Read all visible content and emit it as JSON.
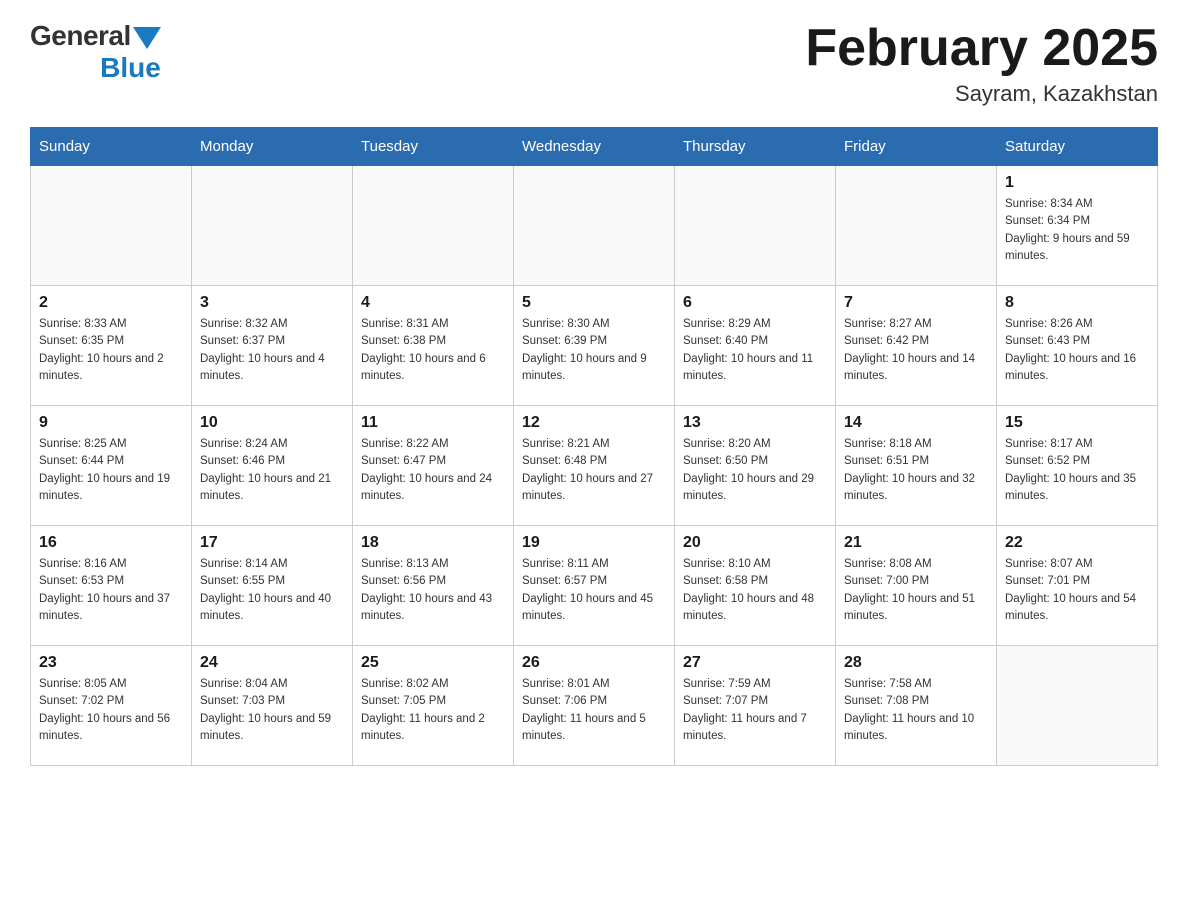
{
  "header": {
    "logo_general": "General",
    "logo_blue": "Blue",
    "title": "February 2025",
    "location": "Sayram, Kazakhstan"
  },
  "weekdays": [
    "Sunday",
    "Monday",
    "Tuesday",
    "Wednesday",
    "Thursday",
    "Friday",
    "Saturday"
  ],
  "weeks": [
    [
      {
        "day": "",
        "info": ""
      },
      {
        "day": "",
        "info": ""
      },
      {
        "day": "",
        "info": ""
      },
      {
        "day": "",
        "info": ""
      },
      {
        "day": "",
        "info": ""
      },
      {
        "day": "",
        "info": ""
      },
      {
        "day": "1",
        "info": "Sunrise: 8:34 AM\nSunset: 6:34 PM\nDaylight: 9 hours and 59 minutes."
      }
    ],
    [
      {
        "day": "2",
        "info": "Sunrise: 8:33 AM\nSunset: 6:35 PM\nDaylight: 10 hours and 2 minutes."
      },
      {
        "day": "3",
        "info": "Sunrise: 8:32 AM\nSunset: 6:37 PM\nDaylight: 10 hours and 4 minutes."
      },
      {
        "day": "4",
        "info": "Sunrise: 8:31 AM\nSunset: 6:38 PM\nDaylight: 10 hours and 6 minutes."
      },
      {
        "day": "5",
        "info": "Sunrise: 8:30 AM\nSunset: 6:39 PM\nDaylight: 10 hours and 9 minutes."
      },
      {
        "day": "6",
        "info": "Sunrise: 8:29 AM\nSunset: 6:40 PM\nDaylight: 10 hours and 11 minutes."
      },
      {
        "day": "7",
        "info": "Sunrise: 8:27 AM\nSunset: 6:42 PM\nDaylight: 10 hours and 14 minutes."
      },
      {
        "day": "8",
        "info": "Sunrise: 8:26 AM\nSunset: 6:43 PM\nDaylight: 10 hours and 16 minutes."
      }
    ],
    [
      {
        "day": "9",
        "info": "Sunrise: 8:25 AM\nSunset: 6:44 PM\nDaylight: 10 hours and 19 minutes."
      },
      {
        "day": "10",
        "info": "Sunrise: 8:24 AM\nSunset: 6:46 PM\nDaylight: 10 hours and 21 minutes."
      },
      {
        "day": "11",
        "info": "Sunrise: 8:22 AM\nSunset: 6:47 PM\nDaylight: 10 hours and 24 minutes."
      },
      {
        "day": "12",
        "info": "Sunrise: 8:21 AM\nSunset: 6:48 PM\nDaylight: 10 hours and 27 minutes."
      },
      {
        "day": "13",
        "info": "Sunrise: 8:20 AM\nSunset: 6:50 PM\nDaylight: 10 hours and 29 minutes."
      },
      {
        "day": "14",
        "info": "Sunrise: 8:18 AM\nSunset: 6:51 PM\nDaylight: 10 hours and 32 minutes."
      },
      {
        "day": "15",
        "info": "Sunrise: 8:17 AM\nSunset: 6:52 PM\nDaylight: 10 hours and 35 minutes."
      }
    ],
    [
      {
        "day": "16",
        "info": "Sunrise: 8:16 AM\nSunset: 6:53 PM\nDaylight: 10 hours and 37 minutes."
      },
      {
        "day": "17",
        "info": "Sunrise: 8:14 AM\nSunset: 6:55 PM\nDaylight: 10 hours and 40 minutes."
      },
      {
        "day": "18",
        "info": "Sunrise: 8:13 AM\nSunset: 6:56 PM\nDaylight: 10 hours and 43 minutes."
      },
      {
        "day": "19",
        "info": "Sunrise: 8:11 AM\nSunset: 6:57 PM\nDaylight: 10 hours and 45 minutes."
      },
      {
        "day": "20",
        "info": "Sunrise: 8:10 AM\nSunset: 6:58 PM\nDaylight: 10 hours and 48 minutes."
      },
      {
        "day": "21",
        "info": "Sunrise: 8:08 AM\nSunset: 7:00 PM\nDaylight: 10 hours and 51 minutes."
      },
      {
        "day": "22",
        "info": "Sunrise: 8:07 AM\nSunset: 7:01 PM\nDaylight: 10 hours and 54 minutes."
      }
    ],
    [
      {
        "day": "23",
        "info": "Sunrise: 8:05 AM\nSunset: 7:02 PM\nDaylight: 10 hours and 56 minutes."
      },
      {
        "day": "24",
        "info": "Sunrise: 8:04 AM\nSunset: 7:03 PM\nDaylight: 10 hours and 59 minutes."
      },
      {
        "day": "25",
        "info": "Sunrise: 8:02 AM\nSunset: 7:05 PM\nDaylight: 11 hours and 2 minutes."
      },
      {
        "day": "26",
        "info": "Sunrise: 8:01 AM\nSunset: 7:06 PM\nDaylight: 11 hours and 5 minutes."
      },
      {
        "day": "27",
        "info": "Sunrise: 7:59 AM\nSunset: 7:07 PM\nDaylight: 11 hours and 7 minutes."
      },
      {
        "day": "28",
        "info": "Sunrise: 7:58 AM\nSunset: 7:08 PM\nDaylight: 11 hours and 10 minutes."
      },
      {
        "day": "",
        "info": ""
      }
    ]
  ]
}
